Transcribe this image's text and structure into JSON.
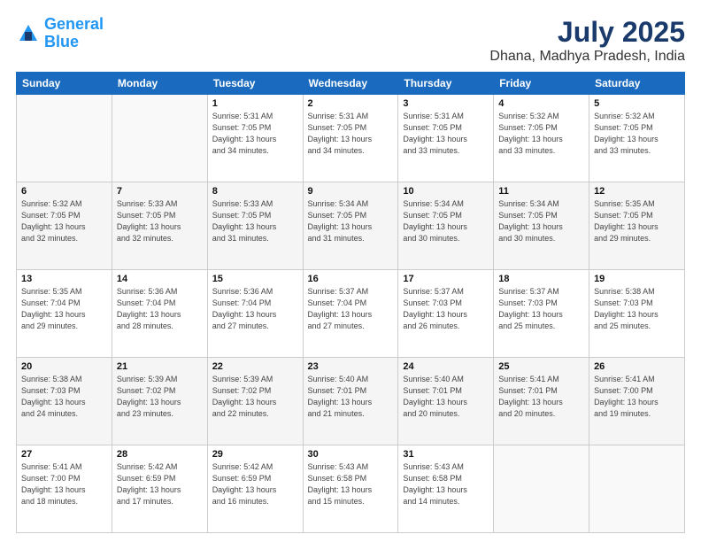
{
  "header": {
    "logo_line1": "General",
    "logo_line2": "Blue",
    "title": "July 2025",
    "subtitle": "Dhana, Madhya Pradesh, India"
  },
  "weekdays": [
    "Sunday",
    "Monday",
    "Tuesday",
    "Wednesday",
    "Thursday",
    "Friday",
    "Saturday"
  ],
  "rows": [
    [
      {
        "day": "",
        "detail": ""
      },
      {
        "day": "",
        "detail": ""
      },
      {
        "day": "1",
        "detail": "Sunrise: 5:31 AM\nSunset: 7:05 PM\nDaylight: 13 hours\nand 34 minutes."
      },
      {
        "day": "2",
        "detail": "Sunrise: 5:31 AM\nSunset: 7:05 PM\nDaylight: 13 hours\nand 34 minutes."
      },
      {
        "day": "3",
        "detail": "Sunrise: 5:31 AM\nSunset: 7:05 PM\nDaylight: 13 hours\nand 33 minutes."
      },
      {
        "day": "4",
        "detail": "Sunrise: 5:32 AM\nSunset: 7:05 PM\nDaylight: 13 hours\nand 33 minutes."
      },
      {
        "day": "5",
        "detail": "Sunrise: 5:32 AM\nSunset: 7:05 PM\nDaylight: 13 hours\nand 33 minutes."
      }
    ],
    [
      {
        "day": "6",
        "detail": "Sunrise: 5:32 AM\nSunset: 7:05 PM\nDaylight: 13 hours\nand 32 minutes."
      },
      {
        "day": "7",
        "detail": "Sunrise: 5:33 AM\nSunset: 7:05 PM\nDaylight: 13 hours\nand 32 minutes."
      },
      {
        "day": "8",
        "detail": "Sunrise: 5:33 AM\nSunset: 7:05 PM\nDaylight: 13 hours\nand 31 minutes."
      },
      {
        "day": "9",
        "detail": "Sunrise: 5:34 AM\nSunset: 7:05 PM\nDaylight: 13 hours\nand 31 minutes."
      },
      {
        "day": "10",
        "detail": "Sunrise: 5:34 AM\nSunset: 7:05 PM\nDaylight: 13 hours\nand 30 minutes."
      },
      {
        "day": "11",
        "detail": "Sunrise: 5:34 AM\nSunset: 7:05 PM\nDaylight: 13 hours\nand 30 minutes."
      },
      {
        "day": "12",
        "detail": "Sunrise: 5:35 AM\nSunset: 7:05 PM\nDaylight: 13 hours\nand 29 minutes."
      }
    ],
    [
      {
        "day": "13",
        "detail": "Sunrise: 5:35 AM\nSunset: 7:04 PM\nDaylight: 13 hours\nand 29 minutes."
      },
      {
        "day": "14",
        "detail": "Sunrise: 5:36 AM\nSunset: 7:04 PM\nDaylight: 13 hours\nand 28 minutes."
      },
      {
        "day": "15",
        "detail": "Sunrise: 5:36 AM\nSunset: 7:04 PM\nDaylight: 13 hours\nand 27 minutes."
      },
      {
        "day": "16",
        "detail": "Sunrise: 5:37 AM\nSunset: 7:04 PM\nDaylight: 13 hours\nand 27 minutes."
      },
      {
        "day": "17",
        "detail": "Sunrise: 5:37 AM\nSunset: 7:03 PM\nDaylight: 13 hours\nand 26 minutes."
      },
      {
        "day": "18",
        "detail": "Sunrise: 5:37 AM\nSunset: 7:03 PM\nDaylight: 13 hours\nand 25 minutes."
      },
      {
        "day": "19",
        "detail": "Sunrise: 5:38 AM\nSunset: 7:03 PM\nDaylight: 13 hours\nand 25 minutes."
      }
    ],
    [
      {
        "day": "20",
        "detail": "Sunrise: 5:38 AM\nSunset: 7:03 PM\nDaylight: 13 hours\nand 24 minutes."
      },
      {
        "day": "21",
        "detail": "Sunrise: 5:39 AM\nSunset: 7:02 PM\nDaylight: 13 hours\nand 23 minutes."
      },
      {
        "day": "22",
        "detail": "Sunrise: 5:39 AM\nSunset: 7:02 PM\nDaylight: 13 hours\nand 22 minutes."
      },
      {
        "day": "23",
        "detail": "Sunrise: 5:40 AM\nSunset: 7:01 PM\nDaylight: 13 hours\nand 21 minutes."
      },
      {
        "day": "24",
        "detail": "Sunrise: 5:40 AM\nSunset: 7:01 PM\nDaylight: 13 hours\nand 20 minutes."
      },
      {
        "day": "25",
        "detail": "Sunrise: 5:41 AM\nSunset: 7:01 PM\nDaylight: 13 hours\nand 20 minutes."
      },
      {
        "day": "26",
        "detail": "Sunrise: 5:41 AM\nSunset: 7:00 PM\nDaylight: 13 hours\nand 19 minutes."
      }
    ],
    [
      {
        "day": "27",
        "detail": "Sunrise: 5:41 AM\nSunset: 7:00 PM\nDaylight: 13 hours\nand 18 minutes."
      },
      {
        "day": "28",
        "detail": "Sunrise: 5:42 AM\nSunset: 6:59 PM\nDaylight: 13 hours\nand 17 minutes."
      },
      {
        "day": "29",
        "detail": "Sunrise: 5:42 AM\nSunset: 6:59 PM\nDaylight: 13 hours\nand 16 minutes."
      },
      {
        "day": "30",
        "detail": "Sunrise: 5:43 AM\nSunset: 6:58 PM\nDaylight: 13 hours\nand 15 minutes."
      },
      {
        "day": "31",
        "detail": "Sunrise: 5:43 AM\nSunset: 6:58 PM\nDaylight: 13 hours\nand 14 minutes."
      },
      {
        "day": "",
        "detail": ""
      },
      {
        "day": "",
        "detail": ""
      }
    ]
  ]
}
